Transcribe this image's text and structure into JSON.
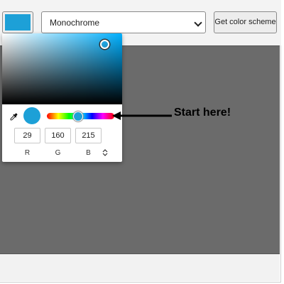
{
  "toolbar": {
    "swatch_color": "#1da0d7",
    "scheme_mode": "Monochrome",
    "get_scheme_label": "Get color scheme"
  },
  "picker": {
    "hue_gradient": "#00b0ff",
    "selected_color": "#1da0d7",
    "rgb": {
      "r": "29",
      "g": "160",
      "b": "215"
    },
    "labels": {
      "r": "R",
      "g": "G",
      "b": "B"
    },
    "mode_toggle_icon": "updown-arrows-icon",
    "eyedropper_icon": "eyedropper-icon"
  },
  "annotation": {
    "text": "Start here!",
    "color": "#000000"
  }
}
